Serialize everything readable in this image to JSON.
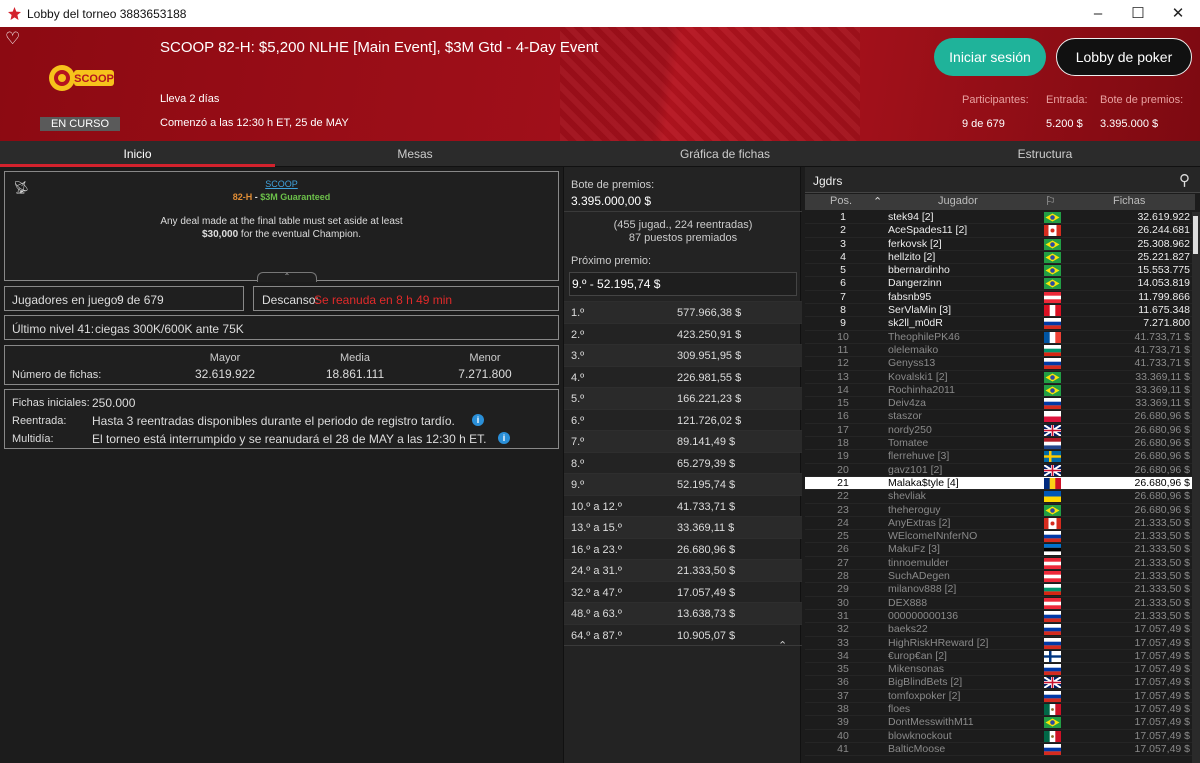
{
  "window": {
    "title": "Lobby del torneo 3883653188"
  },
  "header": {
    "event_name": "SCOOP 82-H: $5,200 NLHE [Main Event], $3M Gtd - 4-Day Event",
    "running_for": "Lleva 2 días",
    "started": "Comenzó a las 12:30 h ET, 25 de MAY",
    "status": "EN CURSO",
    "login": "Iniciar sesión",
    "poker_lobby": "Lobby de poker",
    "stats": [
      {
        "label": "Participantes:",
        "value": "9 de 679"
      },
      {
        "label": "Entrada:",
        "value": "5.200 $"
      },
      {
        "label": "Bote de premios:",
        "value": "3.395.000 $"
      }
    ],
    "logo_text": "SCOOP"
  },
  "tabs": [
    "Inicio",
    "Mesas",
    "Gráfica de fichas",
    "Estructura"
  ],
  "info": {
    "line1": "SCOOP",
    "line2_a": "82-H",
    "line2_b": " - ",
    "line2_c": "$3M Guaranteed",
    "line3": "Any deal made at the final table must set aside at least",
    "line4_a": "$30,000",
    "line4_b": " for the eventual Champion."
  },
  "players_in_game": {
    "label": "Jugadores en juego:",
    "value": "9 de 679"
  },
  "break": {
    "label": "Descanso:",
    "value": "Se reanuda en 8 h 49 min"
  },
  "last_level": {
    "label": "Último nivel 41:",
    "value": "ciegas 300K/600K ante 75K"
  },
  "chips": {
    "label": "Número de fichas:",
    "max_label": "Mayor",
    "max": "32.619.922",
    "avg_label": "Media",
    "avg": "18.861.111",
    "min_label": "Menor",
    "min": "7.271.800"
  },
  "details": {
    "starting_label": "Fichas iniciales:",
    "starting": "250.000",
    "reentry_label": "Reentrada:",
    "reentry": "Hasta 3 reentradas disponibles durante el periodo de registro tardío.",
    "multiday_label": "Multidía:",
    "multiday": "El torneo está interrumpido y se reanudará el 28 de MAY a las 12:30 h ET."
  },
  "prizes": {
    "pool_label": "Bote de premios:",
    "pool": "3.395.000,00 $",
    "entries": "(455 jugad., 224 reentradas)",
    "paid": "87 puestos premiados",
    "next_label": "Próximo premio:",
    "next": "9.º - 52.195,74 $",
    "table": [
      {
        "place": "1.º",
        "amount": "577.966,38 $"
      },
      {
        "place": "2.º",
        "amount": "423.250,91 $"
      },
      {
        "place": "3.º",
        "amount": "309.951,95 $"
      },
      {
        "place": "4.º",
        "amount": "226.981,55 $"
      },
      {
        "place": "5.º",
        "amount": "166.221,23 $"
      },
      {
        "place": "6.º",
        "amount": "121.726,02 $"
      },
      {
        "place": "7.º",
        "amount": "89.141,49 $"
      },
      {
        "place": "8.º",
        "amount": "65.279,39 $"
      },
      {
        "place": "9.º",
        "amount": "52.195,74 $"
      },
      {
        "place": "10.º a 12.º",
        "amount": "41.733,71 $"
      },
      {
        "place": "13.º a 15.º",
        "amount": "33.369,11 $"
      },
      {
        "place": "16.º a 23.º",
        "amount": "26.680,96 $"
      },
      {
        "place": "24.º a 31.º",
        "amount": "21.333,50 $"
      },
      {
        "place": "32.º a 47.º",
        "amount": "17.057,49 $"
      },
      {
        "place": "48.º a 63.º",
        "amount": "13.638,73 $"
      },
      {
        "place": "64.º a 87.º",
        "amount": "10.905,07 $"
      }
    ]
  },
  "search": {
    "value": "Jgdrs"
  },
  "player_columns": {
    "pos": "Pos.",
    "player": "Jugador",
    "chips": "Fichas"
  },
  "players": [
    {
      "pos": "1",
      "name": "stek94 [2]",
      "chips": "32.619.922",
      "flag": "br",
      "elim": false
    },
    {
      "pos": "2",
      "name": "AceSpades11 [2]",
      "chips": "26.244.681",
      "flag": "ca",
      "elim": false
    },
    {
      "pos": "3",
      "name": "ferkovsk [2]",
      "chips": "25.308.962",
      "flag": "br",
      "elim": false
    },
    {
      "pos": "4",
      "name": "hellzito [2]",
      "chips": "25.221.827",
      "flag": "br",
      "elim": false
    },
    {
      "pos": "5",
      "name": "bbernardinho",
      "chips": "15.553.775",
      "flag": "br",
      "elim": false
    },
    {
      "pos": "6",
      "name": "Dangerzinn",
      "chips": "14.053.819",
      "flag": "br",
      "elim": false
    },
    {
      "pos": "7",
      "name": "fabsnb95",
      "chips": "11.799.866",
      "flag": "at",
      "elim": false
    },
    {
      "pos": "8",
      "name": "SerVlaMin [3]",
      "chips": "11.675.348",
      "flag": "pe",
      "elim": false
    },
    {
      "pos": "9",
      "name": "sk2ll_m0dR",
      "chips": "7.271.800",
      "flag": "ru",
      "elim": false
    },
    {
      "pos": "10",
      "name": "TheophilePK46",
      "chips": "41.733,71 $",
      "flag": "fr",
      "elim": true
    },
    {
      "pos": "11",
      "name": "olelemaiko",
      "chips": "41.733,71 $",
      "flag": "bg",
      "elim": true
    },
    {
      "pos": "12",
      "name": "Genyss13",
      "chips": "41.733,71 $",
      "flag": "ru",
      "elim": true
    },
    {
      "pos": "13",
      "name": "Kovalski1 [2]",
      "chips": "33.369,11 $",
      "flag": "br",
      "elim": true
    },
    {
      "pos": "14",
      "name": "Rochinha2011",
      "chips": "33.369,11 $",
      "flag": "br",
      "elim": true
    },
    {
      "pos": "15",
      "name": "Deiv4za",
      "chips": "33.369,11 $",
      "flag": "ru",
      "elim": true
    },
    {
      "pos": "16",
      "name": "staszor",
      "chips": "26.680,96 $",
      "flag": "pl",
      "elim": true
    },
    {
      "pos": "17",
      "name": "nordy250",
      "chips": "26.680,96 $",
      "flag": "gb",
      "elim": true
    },
    {
      "pos": "18",
      "name": "Tomatee",
      "chips": "26.680,96 $",
      "flag": "nl",
      "elim": true
    },
    {
      "pos": "19",
      "name": "flerrehuve [3]",
      "chips": "26.680,96 $",
      "flag": "se",
      "elim": true
    },
    {
      "pos": "20",
      "name": "gavz101 [2]",
      "chips": "26.680,96 $",
      "flag": "gb",
      "elim": true
    },
    {
      "pos": "21",
      "name": "Malaka$tyle [4]",
      "chips": "26.680,96 $",
      "flag": "ro",
      "elim": true
    },
    {
      "pos": "22",
      "name": "shevliak",
      "chips": "26.680,96 $",
      "flag": "ua",
      "elim": true
    },
    {
      "pos": "23",
      "name": "theheroguy",
      "chips": "26.680,96 $",
      "flag": "br",
      "elim": true
    },
    {
      "pos": "24",
      "name": "AnyExtras [2]",
      "chips": "21.333,50 $",
      "flag": "ca",
      "elim": true
    },
    {
      "pos": "25",
      "name": "WElcomeINnferNO",
      "chips": "21.333,50 $",
      "flag": "ru",
      "elim": true
    },
    {
      "pos": "26",
      "name": "MakuFz [3]",
      "chips": "21.333,50 $",
      "flag": "ee",
      "elim": true
    },
    {
      "pos": "27",
      "name": "tinnoemulder",
      "chips": "21.333,50 $",
      "flag": "at",
      "elim": true
    },
    {
      "pos": "28",
      "name": "SuchADegen",
      "chips": "21.333,50 $",
      "flag": "at",
      "elim": true
    },
    {
      "pos": "29",
      "name": "milanov888 [2]",
      "chips": "21.333,50 $",
      "flag": "bg",
      "elim": true
    },
    {
      "pos": "30",
      "name": "DEX888",
      "chips": "21.333,50 $",
      "flag": "at",
      "elim": true
    },
    {
      "pos": "31",
      "name": "000000000136",
      "chips": "21.333,50 $",
      "flag": "ru",
      "elim": true
    },
    {
      "pos": "32",
      "name": "baeks22",
      "chips": "17.057,49 $",
      "flag": "ru",
      "elim": true
    },
    {
      "pos": "33",
      "name": "HighRiskHReward [2]",
      "chips": "17.057,49 $",
      "flag": "ru",
      "elim": true
    },
    {
      "pos": "34",
      "name": "€urop€an [2]",
      "chips": "17.057,49 $",
      "flag": "fi",
      "elim": true
    },
    {
      "pos": "35",
      "name": "Mikensonas",
      "chips": "17.057,49 $",
      "flag": "ru",
      "elim": true
    },
    {
      "pos": "36",
      "name": "BigBlindBets [2]",
      "chips": "17.057,49 $",
      "flag": "gb",
      "elim": true
    },
    {
      "pos": "37",
      "name": "tomfoxpoker [2]",
      "chips": "17.057,49 $",
      "flag": "ru",
      "elim": true
    },
    {
      "pos": "38",
      "name": "floes",
      "chips": "17.057,49 $",
      "flag": "mx",
      "elim": true
    },
    {
      "pos": "39",
      "name": "DontMesswithM11",
      "chips": "17.057,49 $",
      "flag": "br",
      "elim": true
    },
    {
      "pos": "40",
      "name": "blowknockout",
      "chips": "17.057,49 $",
      "flag": "mx",
      "elim": true
    },
    {
      "pos": "41",
      "name": "BalticMoose",
      "chips": "17.057,49 $",
      "flag": "ru",
      "elim": true
    }
  ],
  "selected_pos": "21"
}
